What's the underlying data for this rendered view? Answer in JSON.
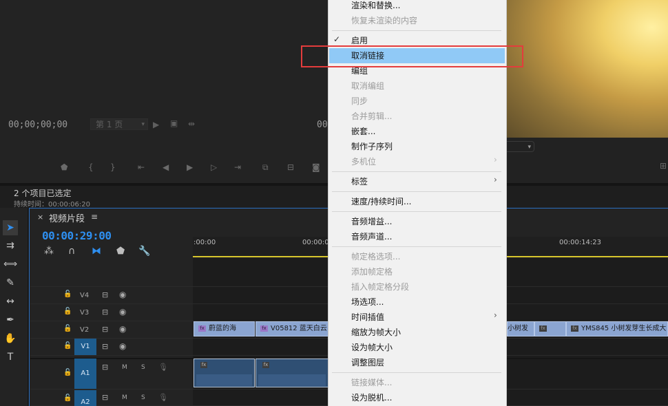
{
  "source_monitor": {
    "timecode": "00;00;00;00",
    "page_select": "第 1 页",
    "program_timecode_partial": "00"
  },
  "info": {
    "items_selected": "2 个项目已选定",
    "duration": "持续时间：00:00:06:20"
  },
  "sequence": {
    "close": "×",
    "title": "视频片段",
    "menu": "≡",
    "timecode": "00:00:29:00"
  },
  "ruler": {
    "labels": [
      ":00:00",
      "00:00:0",
      "00:00:14:23"
    ]
  },
  "tracks": {
    "video": [
      {
        "name": "V4"
      },
      {
        "name": "V3"
      },
      {
        "name": "V2"
      },
      {
        "name": "V1"
      }
    ],
    "audio": [
      {
        "name": "A1",
        "m": "M",
        "s": "S"
      },
      {
        "name": "A2",
        "m": "M",
        "s": "S"
      }
    ]
  },
  "clips": {
    "v2": [
      {
        "fx": "fx",
        "label": "蔚蓝的海"
      },
      {
        "fx": "fx",
        "label": "V05812 蓝天白云"
      },
      {
        "fx": "",
        "label": "小树发"
      },
      {
        "fx": "fx",
        "label": ""
      },
      {
        "fx": "fx",
        "label": "YMS845 小树发芽生长成大"
      }
    ],
    "a1_fx": "fx"
  },
  "context_menu": {
    "items": [
      {
        "label": "渲染和替换...",
        "disabled": false
      },
      {
        "label": "恢复未渲染的内容",
        "disabled": true
      },
      {
        "label": "启用",
        "disabled": false,
        "checked": true
      },
      {
        "label": "取消链接",
        "disabled": false,
        "highlighted": true
      },
      {
        "label": "编组",
        "disabled": false
      },
      {
        "label": "取消编组",
        "disabled": true
      },
      {
        "label": "同步",
        "disabled": true
      },
      {
        "label": "合并剪辑...",
        "disabled": true
      },
      {
        "label": "嵌套...",
        "disabled": false
      },
      {
        "label": "制作子序列",
        "disabled": false
      },
      {
        "label": "多机位",
        "disabled": true,
        "submenu": true
      },
      {
        "label": "标签",
        "disabled": false,
        "submenu": true
      },
      {
        "label": "速度/持续时间...",
        "disabled": false
      },
      {
        "label": "音频增益...",
        "disabled": false
      },
      {
        "label": "音频声道...",
        "disabled": false
      },
      {
        "label": "帧定格选项...",
        "disabled": true
      },
      {
        "label": "添加帧定格",
        "disabled": true
      },
      {
        "label": "插入帧定格分段",
        "disabled": true
      },
      {
        "label": "场选项...",
        "disabled": false
      },
      {
        "label": "时间插值",
        "disabled": false,
        "submenu": true
      },
      {
        "label": "缩放为帧大小",
        "disabled": false
      },
      {
        "label": "设为帧大小",
        "disabled": false
      },
      {
        "label": "调整图层",
        "disabled": false
      },
      {
        "label": "链接媒体...",
        "disabled": true
      },
      {
        "label": "设为脱机...",
        "disabled": false
      }
    ],
    "check_glyph": "✓",
    "arrow_glyph": "›"
  },
  "icons": {
    "selection_tool": "selection-arrow-icon",
    "track_select": "track-select-forward-icon",
    "ripple_edit": "ripple-edit-icon",
    "razor": "razor-icon",
    "slip": "slip-icon",
    "pen": "pen-icon",
    "hand": "hand-icon",
    "type": "type-icon"
  },
  "colors": {
    "accent_blue": "#2e8ff0",
    "menu_highlight": "#90c9f6",
    "annotation_red": "#e43c3c",
    "clip_video": "#8ba5d1",
    "clip_audio": "#2f4f73",
    "playhead_yellow": "#d8c72d"
  }
}
